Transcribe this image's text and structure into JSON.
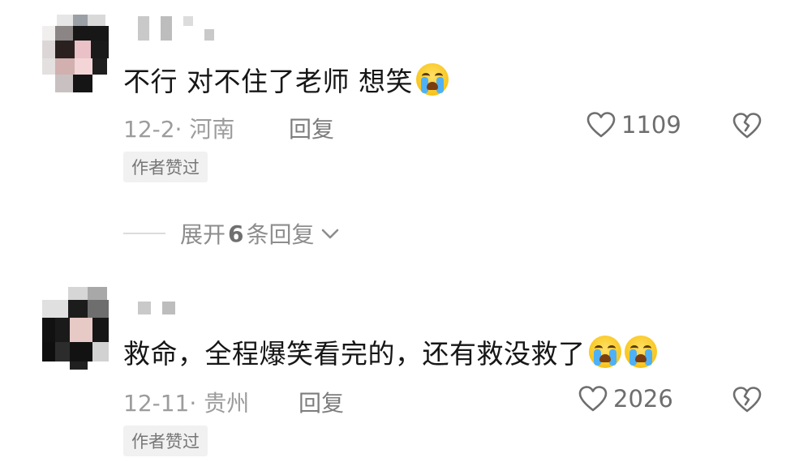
{
  "comments": [
    {
      "text": "不行 对不住了老师 想笑",
      "emojis": [
        "loudly-crying-face-emoji"
      ],
      "date": "12-2",
      "location": "河南",
      "reply_label": "回复",
      "likes": "1109",
      "badge": "作者赞过"
    },
    {
      "text": "救命，全程爆笑看完的，还有救没救了",
      "emojis": [
        "loudly-crying-face-emoji",
        "loudly-crying-face-emoji"
      ],
      "date": "12-11",
      "location": "贵州",
      "reply_label": "回复",
      "likes": "2026",
      "badge": "作者赞过"
    }
  ],
  "expand_replies": {
    "prefix": "展开",
    "count": "6",
    "suffix": "条回复"
  },
  "colors": {
    "text": "#161616",
    "meta": "#9c9c9c",
    "badge_bg": "#f1f1f1"
  },
  "icons": {
    "like": "heart-outline-icon",
    "dislike": "broken-heart-icon",
    "expand": "chevron-down-icon"
  }
}
